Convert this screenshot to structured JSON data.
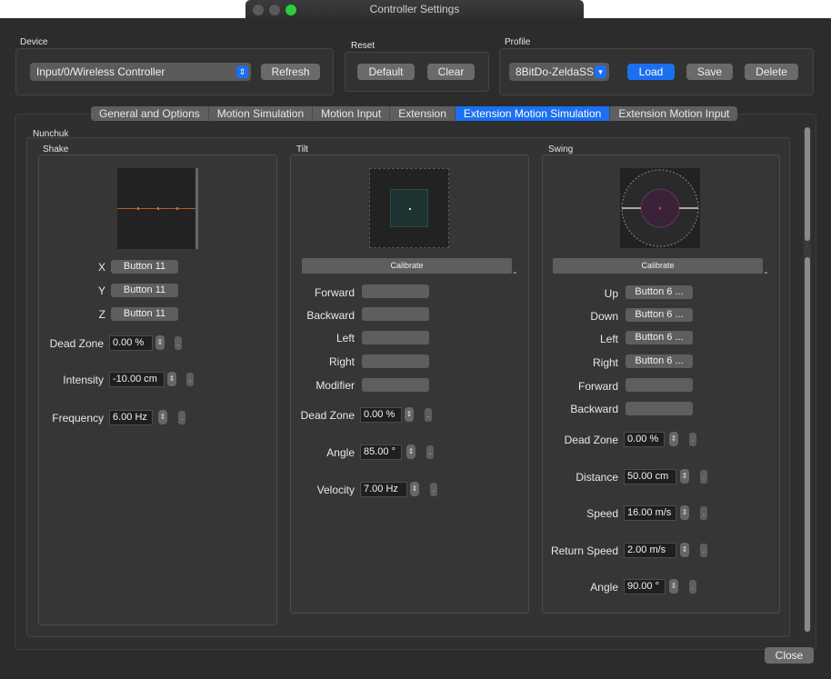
{
  "window": {
    "title": "Controller Settings"
  },
  "device": {
    "group_label": "Device",
    "selected": "Input/0/Wireless Controller",
    "refresh_label": "Refresh"
  },
  "reset": {
    "group_label": "Reset",
    "default_label": "Default",
    "clear_label": "Clear"
  },
  "profile": {
    "group_label": "Profile",
    "selected": "8BitDo-ZeldaSS",
    "load_label": "Load",
    "save_label": "Save",
    "delete_label": "Delete"
  },
  "tabs": [
    {
      "label": "General and Options"
    },
    {
      "label": "Motion Simulation"
    },
    {
      "label": "Motion Input"
    },
    {
      "label": "Extension"
    },
    {
      "label": "Extension Motion Simulation"
    },
    {
      "label": "Extension Motion Input"
    }
  ],
  "active_tab": "Extension Motion Simulation",
  "nunchuk": {
    "label": "Nunchuk",
    "shake": {
      "label": "Shake",
      "axes": [
        {
          "label": "X",
          "value": "Button 11"
        },
        {
          "label": "Y",
          "value": "Button 11"
        },
        {
          "label": "Z",
          "value": "Button 11"
        }
      ],
      "dead_zone": {
        "label": "Dead Zone",
        "value": "0.00 %"
      },
      "intensity": {
        "label": "Intensity",
        "value": "-10.00 cm"
      },
      "frequency": {
        "label": "Frequency",
        "value": "6.00 Hz"
      }
    },
    "tilt": {
      "label": "Tilt",
      "calibrate_label": "Calibrate",
      "dirs": [
        {
          "label": "Forward",
          "value": ""
        },
        {
          "label": "Backward",
          "value": ""
        },
        {
          "label": "Left",
          "value": ""
        },
        {
          "label": "Right",
          "value": ""
        },
        {
          "label": "Modifier",
          "value": ""
        }
      ],
      "dead_zone": {
        "label": "Dead Zone",
        "value": "0.00 %"
      },
      "angle": {
        "label": "Angle",
        "value": "85.00 °"
      },
      "velocity": {
        "label": "Velocity",
        "value": "7.00 Hz"
      }
    },
    "swing": {
      "label": "Swing",
      "calibrate_label": "Calibrate",
      "dirs": [
        {
          "label": "Up",
          "value": "Button 6 ..."
        },
        {
          "label": "Down",
          "value": "Button 6 ..."
        },
        {
          "label": "Left",
          "value": "Button 6 ..."
        },
        {
          "label": "Right",
          "value": "Button 6 ..."
        },
        {
          "label": "Forward",
          "value": ""
        },
        {
          "label": "Backward",
          "value": ""
        }
      ],
      "dead_zone": {
        "label": "Dead Zone",
        "value": "0.00 %"
      },
      "distance": {
        "label": "Distance",
        "value": "50.00 cm"
      },
      "speed": {
        "label": "Speed",
        "value": "16.00 m/s"
      },
      "return_speed": {
        "label": "Return Speed",
        "value": "2.00 m/s"
      },
      "angle": {
        "label": "Angle",
        "value": "90.00 °"
      }
    }
  },
  "close_label": "Close",
  "colors": {
    "accent": "#1b6ff0",
    "background": "#2c2c2c"
  }
}
